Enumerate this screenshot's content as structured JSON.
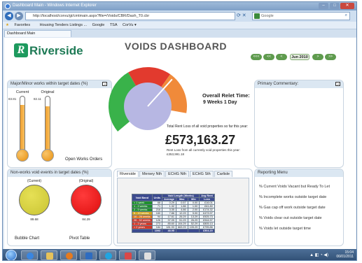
{
  "window": {
    "title": "Dashboard Main - Windows Internet Explorer",
    "minimize": "–",
    "maximize": "□",
    "close": "✕"
  },
  "address_bar": {
    "url": "http://localhost/corvu/gi/cmtmain.aspx?file=/Voids/CBR/Dash_T0.cbr",
    "search_placeholder": "Google"
  },
  "favorites_bar": {
    "favorites": "Favorites",
    "items": [
      "Housing Tenders Listings ...",
      "Google",
      "TSA",
      "CorVu ▾"
    ]
  },
  "tab": {
    "label": "Dashboard Main"
  },
  "brand": {
    "logo_letter": "R",
    "name": "Riverside"
  },
  "dashboard": {
    "title": "VOIDS DASHBOARD",
    "date": "Jun 2010",
    "nav_labels": [
      "<<<",
      "<<",
      "<",
      ">",
      ">>"
    ]
  },
  "major_minor": {
    "title": "Major/Minor works within target dates (%)",
    "current_label": "Current",
    "original_label": "Original",
    "current_value": "83.81",
    "original_value": "82.11",
    "current_level": 0.84,
    "original_level": 0.82,
    "footer": "Open Works Orders"
  },
  "gauge": {
    "relet_title": "Overall Relet Time:",
    "relet_value": "9 Weeks 1 Day",
    "rent_label": "Total Rent Loss of all void properties so far this year:",
    "rent_amount": "£573,163.27",
    "rent_current": "Rent Loss from all currently void properties this year: £353,991.18",
    "colors": {
      "red": "#e23a2e",
      "orange": "#f08a3a",
      "green": "#39b24a",
      "lilac": "#b7b7e3",
      "needle": "#ffffff"
    }
  },
  "commentary": {
    "title": "Primary Commentary:"
  },
  "non_works": {
    "title": "Non-works void events in target dates (%)",
    "current_label": "(Current)",
    "original_label": "(Original)",
    "current_value": "89.68",
    "original_value": "84.29",
    "footer_left": "Bubble Chart",
    "footer_right": "Pivot Table"
  },
  "area_tabs": {
    "tabs": [
      "Riverside",
      "Mersey Nth",
      "ECHG Nth",
      "ECHG Sth",
      "Carlisle"
    ],
    "table": {
      "headers": [
        "Void Band",
        "Units",
        "Average",
        "Max",
        "Min",
        "Loss"
      ],
      "group_header": "Void Length (Weeks)",
      "loss_header": "Avg Rent",
      "rows": [
        {
          "band": "< 1 week",
          "units": "68",
          "avg": "0.29",
          "max": "0.57",
          "min": "0.00",
          "loss": "£16.01",
          "color": "#1f8f2e"
        },
        {
          "band": "1 - 2 weeks",
          "units": "71",
          "avg": "1.32",
          "max": "1.86",
          "min": "1.00",
          "loss": "£61.80",
          "color": "#1f8f2e"
        },
        {
          "band": "2 - 5 weeks",
          "units": "216",
          "avg": "3.35",
          "max": "4.86",
          "min": "2.00",
          "loss": "£174.32",
          "color": "#1f8f2e"
        },
        {
          "band": "5 - 10 weeks",
          "units": "160",
          "avg": "7.86",
          "max": "12.29",
          "min": "5.00",
          "loss": "£473.97",
          "color": "#d6a81c"
        },
        {
          "band": "10 - 26 weeks",
          "units": "94",
          "avg": "17.61",
          "max": "26.29",
          "min": "13.29",
          "loss": "£925.73",
          "color": "#e07a1e"
        },
        {
          "band": "26 - 52 weeks",
          "units": "126",
          "avg": "37.05",
          "max": "51.29",
          "min": "26.29",
          "loss": "£944.57",
          "color": "#d23a2a"
        },
        {
          "band": "1 - 2 years",
          "units": "273",
          "avg": "85.60",
          "max": "104.29",
          "min": "52.29",
          "loss": "£805.13",
          "color": "#d23a2a"
        },
        {
          "band": "> 2 years",
          "units": "184",
          "avg": "181.93",
          "max": "663.29",
          "min": "105.29",
          "loss": "£795.86",
          "color": "#d23a2a"
        }
      ],
      "total": {
        "band": "",
        "units": "1093",
        "avg": "48.95",
        "max": "",
        "min": "",
        "loss": "£504.20"
      }
    }
  },
  "reporting_menu": {
    "title": "Reporting Menu",
    "items": [
      "% Current Voids Vacant but Ready To Let",
      "% Incomplete works outside target date",
      "% Gas cap off work outside target date",
      "% Voids clear out outside target date",
      "% Voids let outside target time"
    ]
  },
  "taskbar": {
    "time": "15:04",
    "date": "06/01/2011"
  }
}
